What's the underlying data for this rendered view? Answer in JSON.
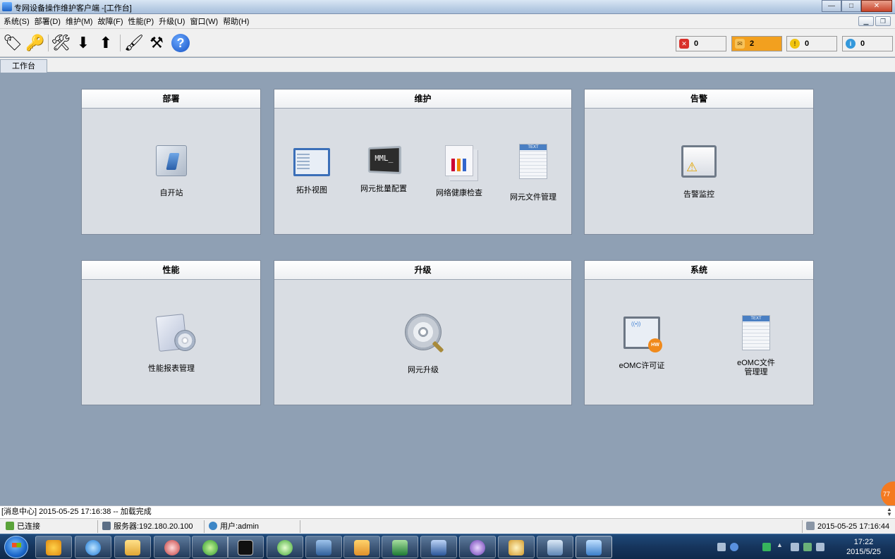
{
  "window": {
    "title": "专网设备操作维护客户端 -[工作台]",
    "controls": [
      "—",
      "□",
      "✕"
    ]
  },
  "menu": {
    "items": [
      "系统(S)",
      "部署(D)",
      "维护(M)",
      "故障(F)",
      "性能(P)",
      "升级(U)",
      "窗口(W)",
      "帮助(H)"
    ]
  },
  "toolbar": {
    "alarm_counts": [
      {
        "name": "critical",
        "value": "0",
        "color": "#d9302a",
        "bg": "#ffffff"
      },
      {
        "name": "major",
        "value": "2",
        "color": "#f39c12",
        "bg": "#f2a01f"
      },
      {
        "name": "minor",
        "value": "0",
        "color": "#f1c40f",
        "bg": "#ffffff"
      },
      {
        "name": "info",
        "value": "0",
        "color": "#3498db",
        "bg": "#ffffff"
      }
    ]
  },
  "tabs": [
    "工作台"
  ],
  "panels": {
    "deploy": {
      "title": "部署",
      "items": [
        "自开站"
      ]
    },
    "maintain": {
      "title": "维护",
      "items": [
        "拓扑视图",
        "网元批量配置",
        "网络健康检查",
        "网元文件管理"
      ]
    },
    "alarm": {
      "title": "告警",
      "items": [
        "告警监控"
      ]
    },
    "performance": {
      "title": "性能",
      "items": [
        "性能报表管理"
      ]
    },
    "upgrade": {
      "title": "升级",
      "items": [
        "网元升级"
      ]
    },
    "system": {
      "title": "系统",
      "items": [
        "eOMC许可证",
        "eOMC文件管理理"
      ]
    }
  },
  "mml_icon_text": "MML_",
  "message": "[消息中心] 2015-05-25 17:16:38 -- 加载完成",
  "badge": "77",
  "status": {
    "connection": "已连接",
    "server": "服务器:192.180.20.100",
    "user": "用户:admin",
    "datetime": "2015-05-25 17:16:44"
  },
  "taskbar": {
    "time": "17:22",
    "date": "2015/5/25"
  }
}
